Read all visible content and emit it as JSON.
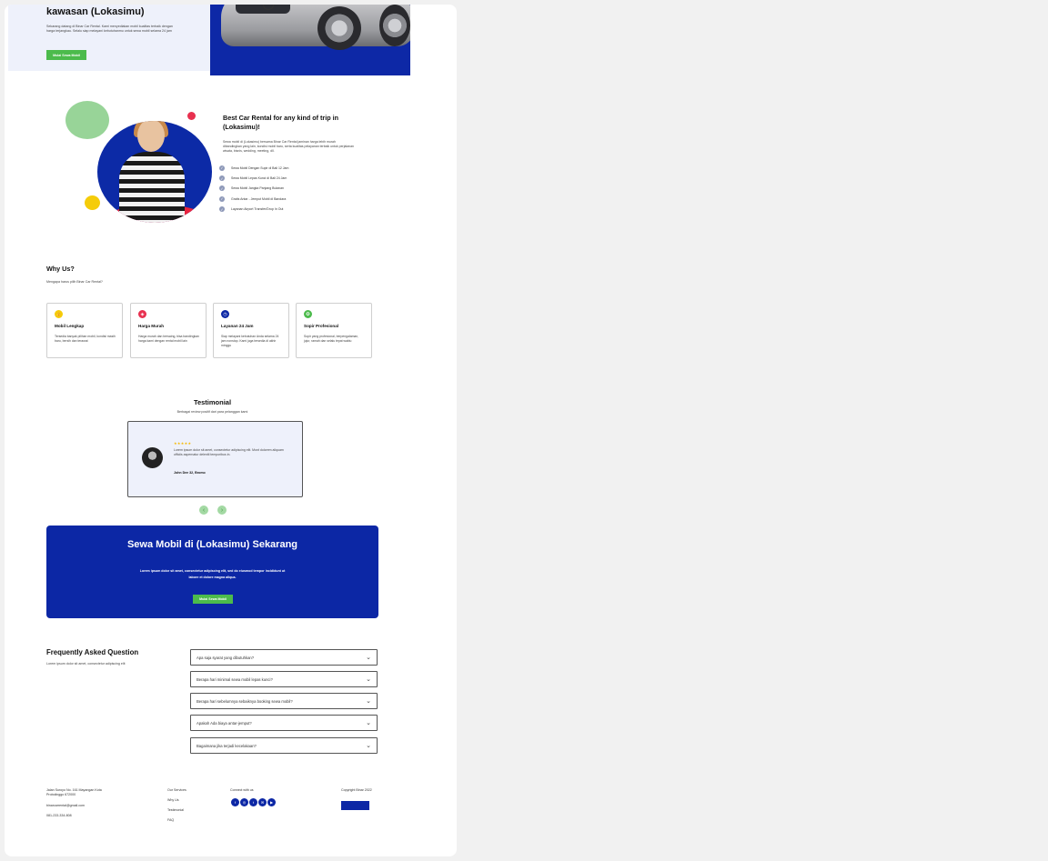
{
  "hero": {
    "title": "kawasan (Lokasimu)",
    "text": "Sekarang datang di Binar Car Rental. Kami menyediakan mobil kualitas terbaik dengan harga terjangkau. Selalu siap melayani kebutuhanmu untuk sewa mobil selama 24 jam",
    "button": "Mulai Sewa Mobil"
  },
  "about": {
    "title": "Best Car Rental for any kind of trip in (Lokasimu)!",
    "text": "Sewa mobil di (Lokasimu) bersama Binar Car Rental jaminan harga lebih murah dibandingkan yang lain, kondisi mobil baru, serta kualitas pelayanan terbaik untuk perjalanan wisata, bisnis, wedding, meeting, dll.",
    "items": [
      "Sewa Mobil Dengan Supir di Bali 12 Jam",
      "Sewa Mobil Lepas Kunci di Bali 24 Jam",
      "Sewa Mobil Jangka Panjang Bulanan",
      "Gratis Antar - Jemput Mobil di Bandara",
      "Layanan Airport Transfer/Drop In Out"
    ]
  },
  "why": {
    "title": "Why Us?",
    "subtitle": "Mengapa harus pilih Binar Car Rental?",
    "cards": [
      {
        "title": "Mobil Lengkap",
        "text": "Tersedia banyak pilihan mobil, kondisi masih baru, bersih dan terawat",
        "color": "#f5cc09",
        "icon": "thumbs-up-icon",
        "glyph": "👍"
      },
      {
        "title": "Harga Murah",
        "text": "Harga murah dan bersaing, bisa bandingkan harga kami dengan rental mobil lain",
        "color": "#e8304f",
        "icon": "price-tag-icon",
        "glyph": "◈"
      },
      {
        "title": "Layanan 24 Jam",
        "text": "Siap melayani kebutuhan Anda selama 24 jam nonstop. Kami juga tersedia di akhir minggu",
        "color": "#0c27a5",
        "icon": "clock-icon",
        "glyph": "◷"
      },
      {
        "title": "Sopir Profesional",
        "text": "Sopir yang profesional, berpengalaman, jujur, ramah dan selalu tepat waktu",
        "color": "#4cbb4c",
        "icon": "badge-icon",
        "glyph": "✪"
      }
    ]
  },
  "testimonial": {
    "title": "Testimonial",
    "subtitle": "Berbagai review positif dari para pelanggan kami",
    "stars": "★★★★★",
    "text": "Lorem ipsum dolor sit amet, consectetur adipiscing elit. Mont dolorem aliquam officiis aspernatur deleniti temporibus in.",
    "name": "John Dee 32, Bromo",
    "prev": "‹",
    "next": "›"
  },
  "cta": {
    "title": "Sewa Mobil di (Lokasimu) Sekarang",
    "text": "Lorem ipsum dolor sit amet, consectetur adipiscing elit, sed do eiusmod tempor incididunt ut labore et dolore magna aliqua.",
    "button": "Mulai Sewa Mobil"
  },
  "faq": {
    "title": "Frequently Asked Question",
    "subtitle": "Lorem ipsum dolor sit amet, consectetur adipiscing elit",
    "items": [
      "Apa saja syarat yang dibutuhkan?",
      "Berapa hari minimal sewa mobil lepas kunci?",
      "Berapa hari sebelumnya sebaiknya booking sewa mobil?",
      "Apakah Ada biaya antar-jemput?",
      "Bagaimana jika terjadi kecelakaan?"
    ]
  },
  "footer": {
    "address": "Jalan Suroyo No. 161 Mayangan Kota Probolinggo 672000",
    "email": "binarcarrental@gmail.com",
    "phone": "081-233-334-808",
    "links": [
      "Our Services",
      "Why Us",
      "Testimonial",
      "FAQ"
    ],
    "connect": "Connect with us",
    "social": [
      "f",
      "◎",
      "t",
      "✉",
      "▶"
    ],
    "copyright": "Copyright Binar 2022"
  }
}
